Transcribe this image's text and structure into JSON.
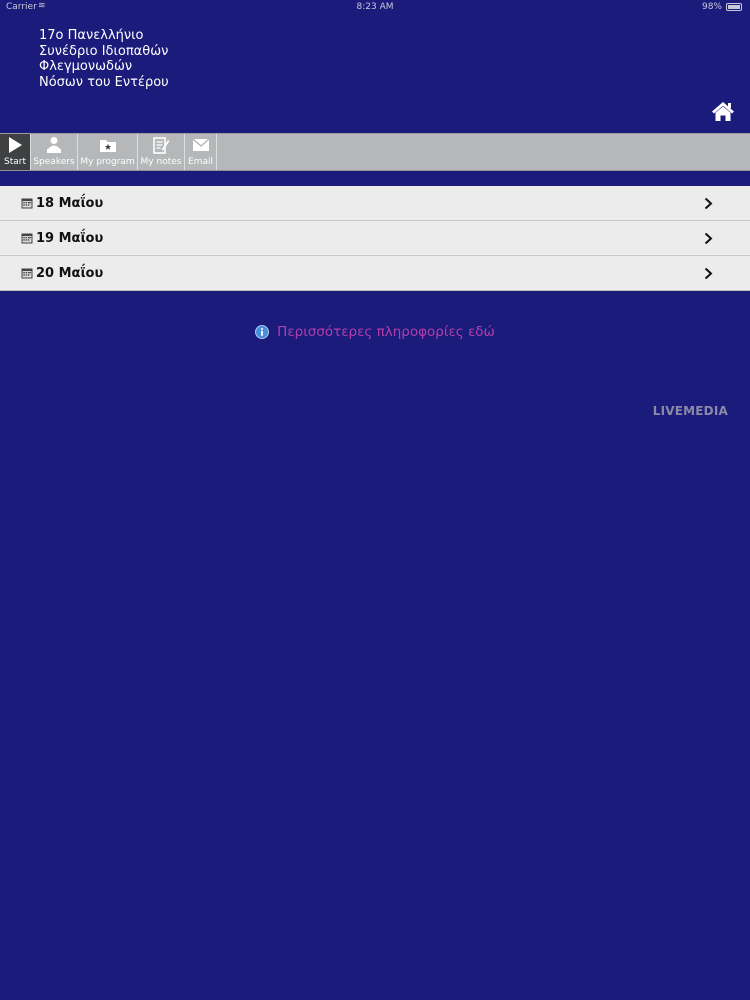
{
  "status_bar": {
    "carrier": "Carrier",
    "time": "8:23 AM",
    "battery": "98%",
    "battery_level": 0.98
  },
  "header": {
    "title": "17ο Πανελλήνιο\nΣυνέδριο Ιδιοπαθών\nΦλεγμονωδών\nΝόσων του Εντέρου",
    "home_icon": "home-icon"
  },
  "tabbar": {
    "tabs": [
      {
        "label": "Start",
        "icon": "play-icon",
        "active": true
      },
      {
        "label": "Speakers",
        "icon": "speaker-icon",
        "active": false
      },
      {
        "label": "My program",
        "icon": "folder-star-icon",
        "active": false
      },
      {
        "label": "My notes",
        "icon": "notes-icon",
        "active": false
      },
      {
        "label": "Email",
        "icon": "envelope-icon",
        "active": false
      }
    ]
  },
  "days": [
    {
      "label": "18 Μαΐου"
    },
    {
      "label": "19 Μαΐου"
    },
    {
      "label": "20 Μαΐου"
    }
  ],
  "more_info": {
    "text": "Περισσότερες πληροφορίες εδώ"
  },
  "brand": "LIVEMEDIA",
  "colors": {
    "background": "#1b1b7c",
    "tabbar": "#b5b7b8",
    "link": "#b43ea8",
    "list_bg": "#ececec"
  }
}
